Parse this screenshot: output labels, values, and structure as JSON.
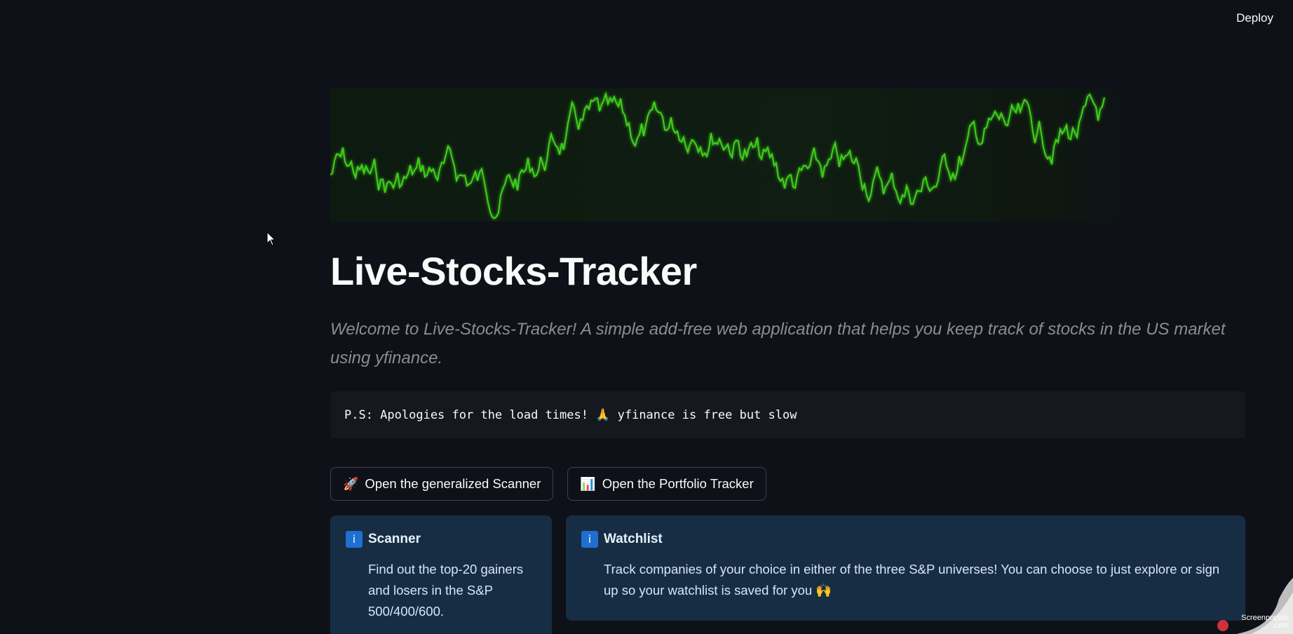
{
  "header": {
    "deploy_label": "Deploy"
  },
  "hero": {
    "title": "Live-Stocks-Tracker",
    "subtitle": "Welcome to Live-Stocks-Tracker! A simple add-free web application that helps you keep track of stocks in the US market using yfinance.",
    "notice": "P.S: Apologies for the load times! 🙏 yfinance is free but slow"
  },
  "actions": [
    {
      "icon": "🚀",
      "label": "Open the generalized Scanner"
    },
    {
      "icon": "📊",
      "label": "Open the Portfolio Tracker"
    }
  ],
  "cards": {
    "scanner": {
      "icon": "i",
      "title": "Scanner",
      "body": "Find out the top-20 gainers and losers in the S&P 500/400/600."
    },
    "watchlist": {
      "icon": "i",
      "title": "Watchlist",
      "body": "Track companies of your choice in either of the three S&P universes! You can choose to just explore or sign up so your watchlist is saved for you 🙌"
    }
  },
  "watermark": {
    "line1": "Screenpresso",
    "line2": ".com"
  },
  "colors": {
    "background": "#0e1117",
    "banner_line": "#3fcf1f",
    "info_card": "#172d43",
    "info_icon": "#1f6fd1"
  },
  "icons": {
    "banner": "stock-ticker-line",
    "info": "info-icon",
    "cursor": "mouse-pointer-icon"
  }
}
